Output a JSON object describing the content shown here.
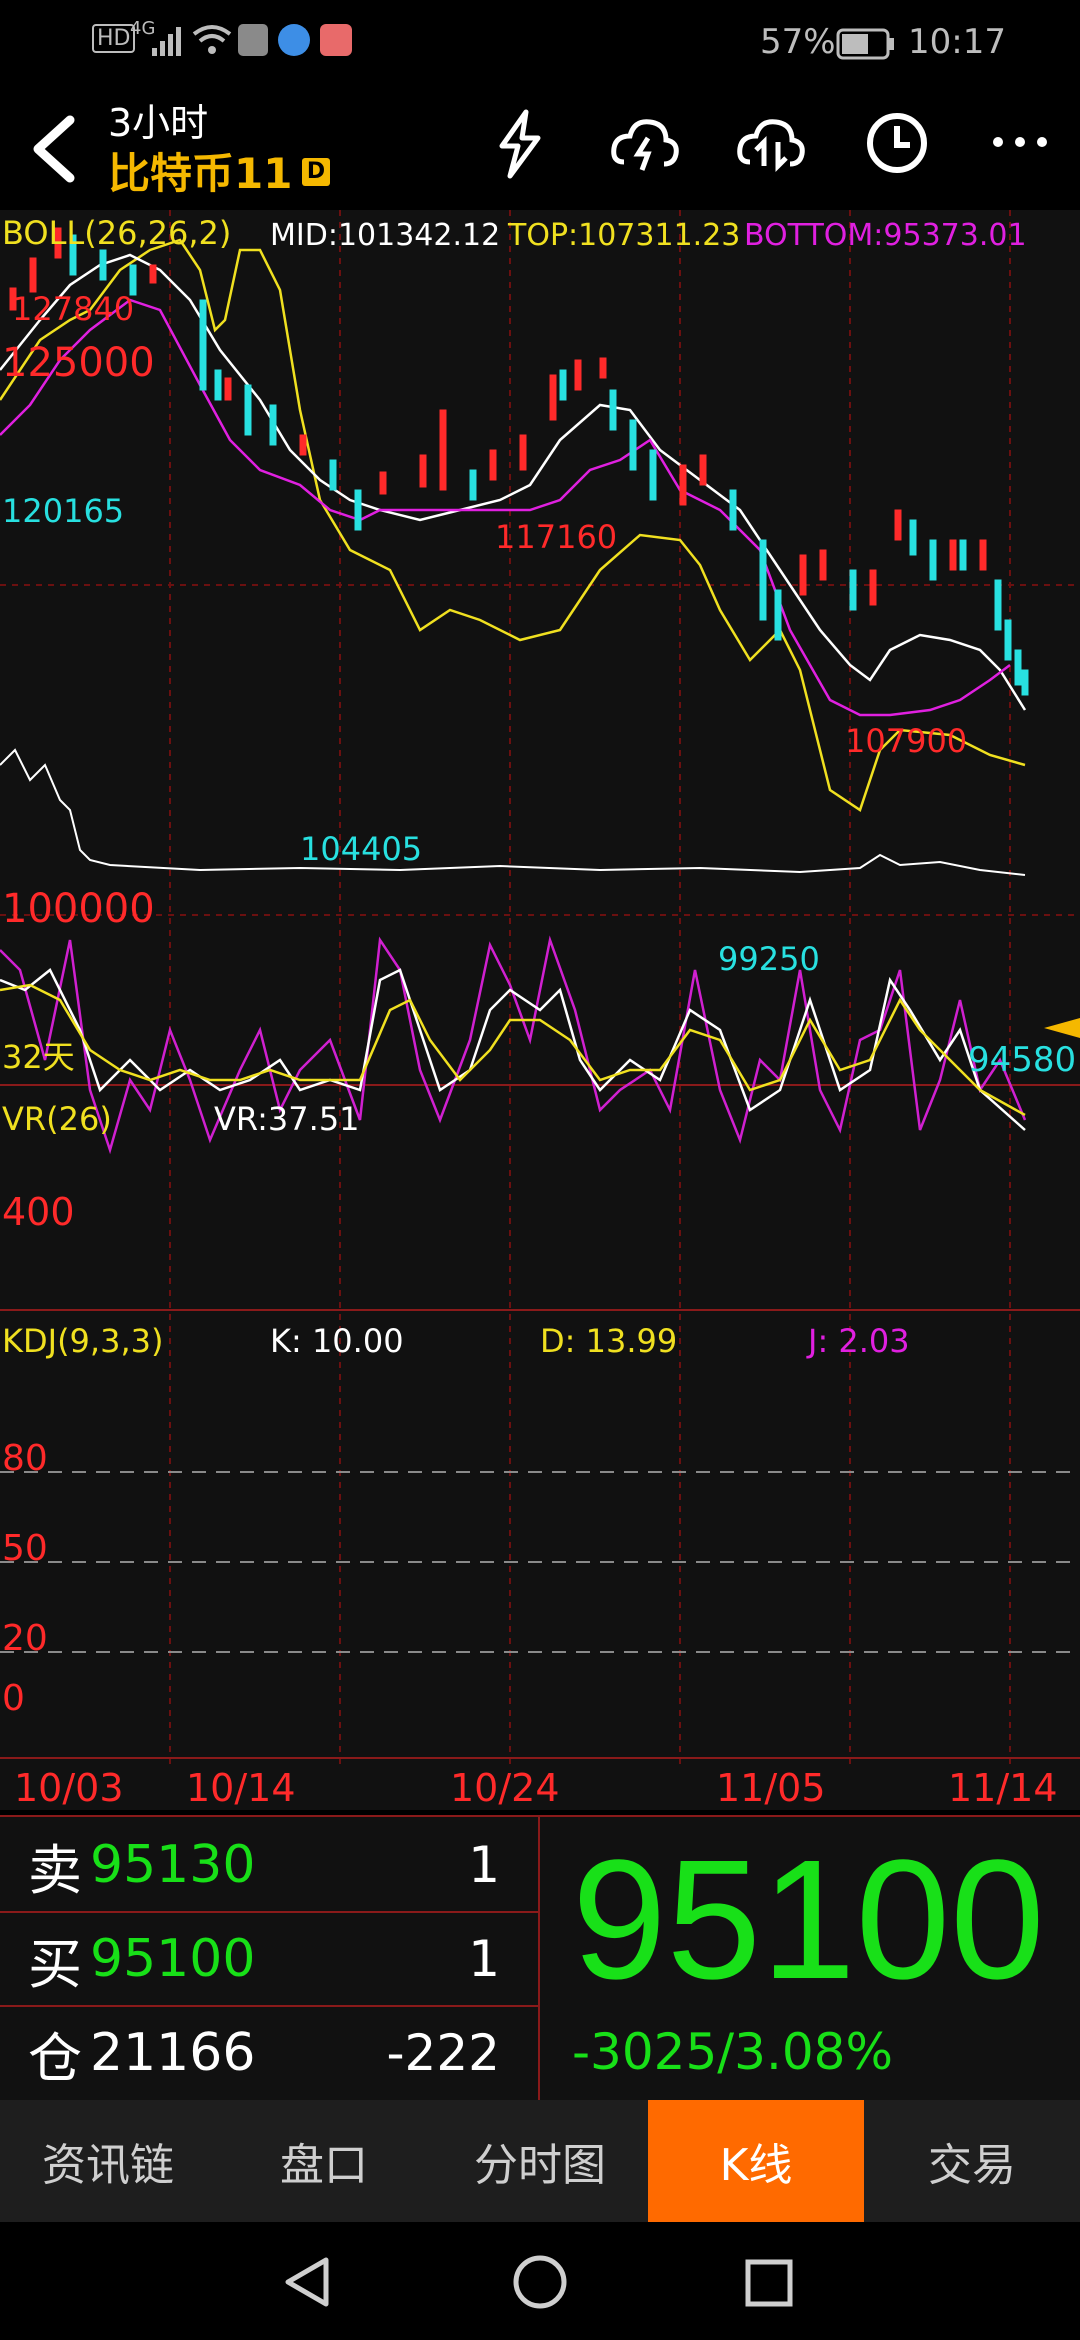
{
  "status": {
    "hd": "HD",
    "net": "4G",
    "battery": "57%",
    "time": "10:17"
  },
  "header": {
    "period": "3小时",
    "symbol": "比特币11",
    "badge": "D"
  },
  "boll": {
    "label": "BOLL(26,26,2)",
    "mid": "MID:101342.12",
    "top": "TOP:107311.23",
    "bottom": "BOTTOM:95373.01"
  },
  "main_chart": {
    "price_labels": [
      "127840",
      "125000",
      "120165",
      "117160",
      "104405",
      "107900",
      "99250",
      "100000",
      "94580"
    ],
    "span": "32天"
  },
  "vr": {
    "label": "VR(26)",
    "value": "VR:37.51",
    "level": "400"
  },
  "kdj": {
    "label": "KDJ(9,3,3)",
    "k": "K: 10.00",
    "d": "D: 13.99",
    "j": "J: 2.03",
    "levels": [
      "80",
      "50",
      "20",
      "0"
    ]
  },
  "dates": [
    "10/03",
    "10/14",
    "10/24",
    "11/05",
    "11/14"
  ],
  "quote": {
    "sell_label": "卖",
    "sell_price": "95130",
    "sell_qty": "1",
    "buy_label": "买",
    "buy_price": "95100",
    "buy_qty": "1",
    "oi_label": "仓",
    "oi_value": "21166",
    "oi_change": "-222",
    "last": "95100",
    "change": "-3025/3.08%"
  },
  "tabs": [
    "资讯链",
    "盘口",
    "分时图",
    "K线",
    "交易"
  ],
  "active_tab": "K线",
  "colors": {
    "up": "#ff2a2a",
    "down": "#28e0e0",
    "mid": "#ffffff",
    "top": "#f0e020",
    "bottom": "#e020e0",
    "accent": "#ff6a00",
    "green": "#18e018"
  }
}
